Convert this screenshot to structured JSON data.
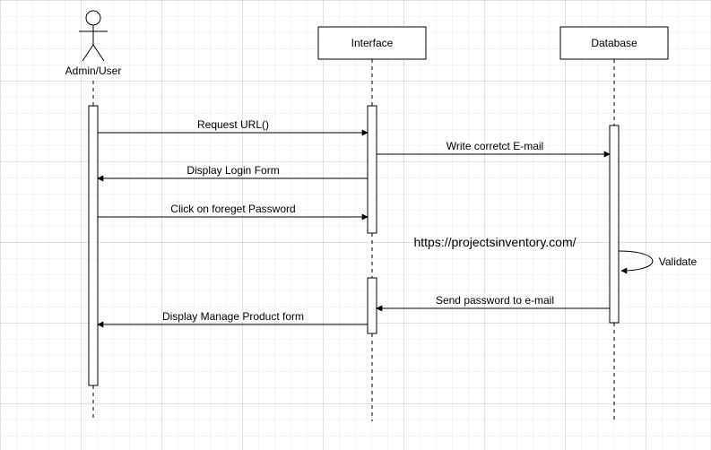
{
  "actors": {
    "admin": "Admin/User",
    "interface": "Interface",
    "database": "Database"
  },
  "messages": {
    "reqUrl": "Request URL()",
    "writeEmail": "Write corretct E-mail",
    "displayLogin": "Display Login Form",
    "clickForget": "Click on foreget Password",
    "validate": "Validate",
    "sendPw": "Send password to e-mail",
    "displayManage": "Display Manage Product form"
  },
  "watermark": "https://projectsinventory.com/"
}
